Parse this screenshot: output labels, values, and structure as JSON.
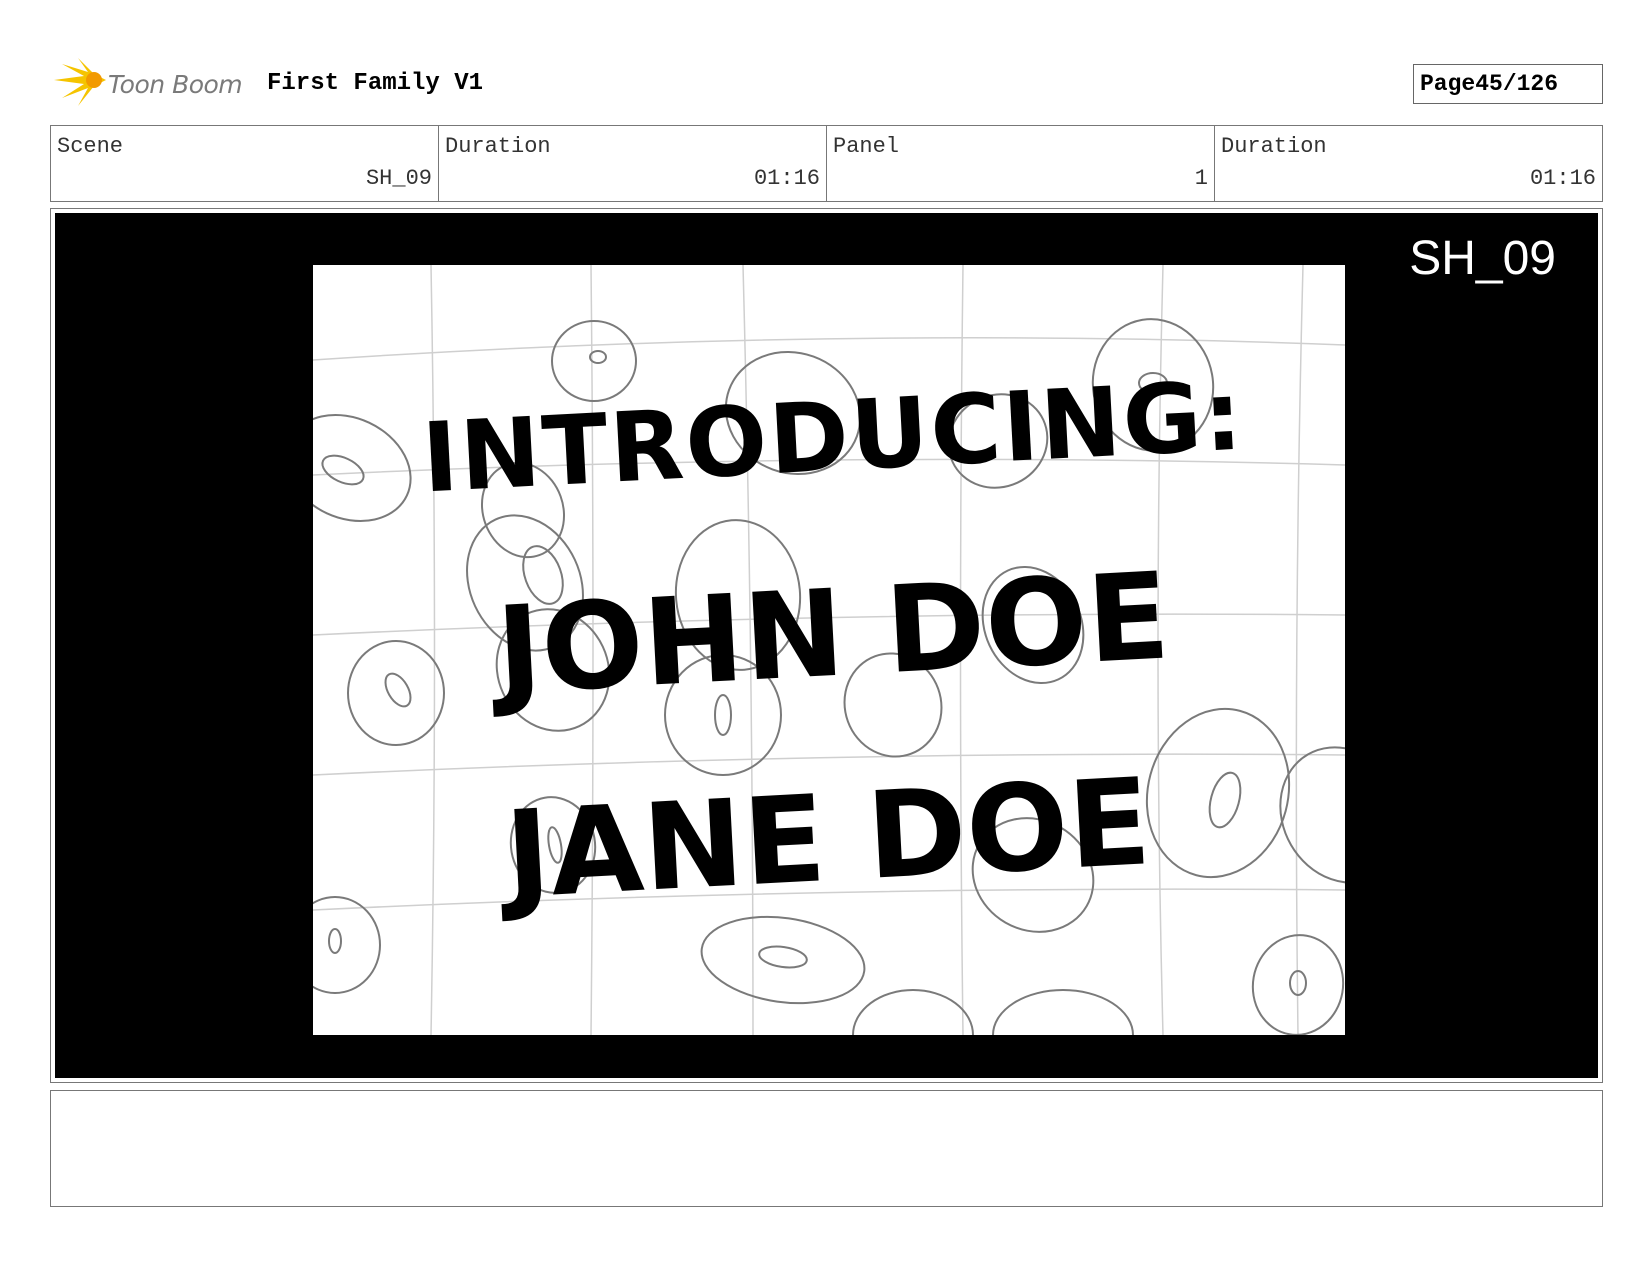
{
  "header": {
    "logo_text": "Toon Boom",
    "project_title": "First Family V1",
    "page_label": "Page",
    "page_number": "45/126"
  },
  "info": {
    "scene_label": "Scene",
    "scene_value": "SH_09",
    "scene_duration_label": "Duration",
    "scene_duration_value": "01:16",
    "panel_label": "Panel",
    "panel_value": "1",
    "panel_duration_label": "Duration",
    "panel_duration_value": "01:16"
  },
  "frame": {
    "shot_label": "SH_09",
    "title_lines": [
      "INTRODUCING:",
      "JOHN DOE",
      "JANE DOE"
    ]
  },
  "colors": {
    "logo_yellow": "#f5c400",
    "logo_orange": "#f29a00",
    "sketch_line": "#777777",
    "grid_line": "#cccccc"
  },
  "notes": {
    "text": ""
  }
}
